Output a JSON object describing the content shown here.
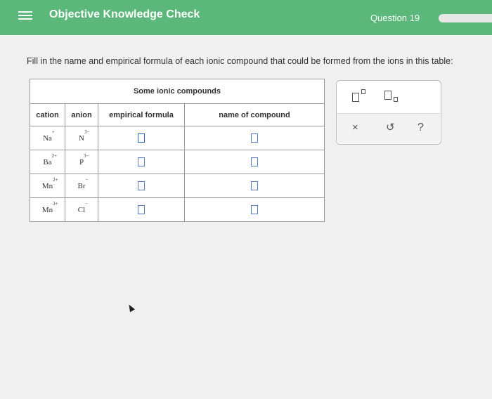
{
  "header": {
    "title": "Objective Knowledge Check",
    "question_label": "Question 19",
    "progress": 0.0
  },
  "prompt": "Fill in the name and empirical formula of each ionic compound that could be formed from the ions in this table:",
  "table": {
    "caption": "Some ionic compounds",
    "columns": [
      "cation",
      "anion",
      "empirical formula",
      "name of compound"
    ],
    "rows": [
      {
        "cation": "Na",
        "cation_charge": "+",
        "anion": "N",
        "anion_charge": "3−",
        "formula": "",
        "name": ""
      },
      {
        "cation": "Ba",
        "cation_charge": "2+",
        "anion": "P",
        "anion_charge": "3−",
        "formula": "",
        "name": ""
      },
      {
        "cation": "Mn",
        "cation_charge": "2+",
        "anion": "Br",
        "anion_charge": "−",
        "formula": "",
        "name": ""
      },
      {
        "cation": "Mn",
        "cation_charge": "3+",
        "anion": "Cl",
        "anion_charge": "−",
        "formula": "",
        "name": ""
      }
    ]
  },
  "toolbar": {
    "clear_symbol": "×",
    "undo_symbol": "↺",
    "help_symbol": "?"
  },
  "colors": {
    "header_green": "#5cb87a",
    "answer_box_blue": "#5a7ec7"
  }
}
